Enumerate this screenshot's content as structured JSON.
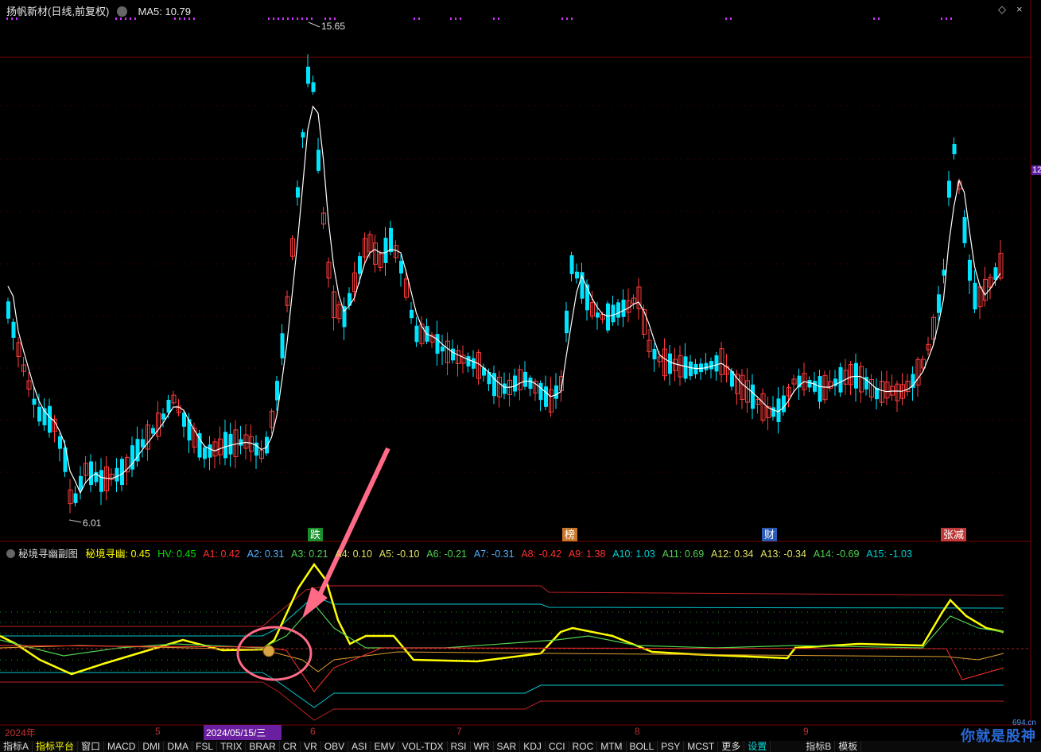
{
  "header": {
    "title": "扬帆新材(日线,前复权)",
    "ma_label": "MA5: 10.79"
  },
  "window_icons": {
    "diamond": "◇",
    "close": "×"
  },
  "price_labels": {
    "high": "15.65",
    "low": "6.01"
  },
  "right_axis_mark": "12",
  "event_tags": [
    {
      "label": "跌",
      "color": "#1a8f2e"
    },
    {
      "label": "榜",
      "color": "#c8762a"
    },
    {
      "label": "财",
      "color": "#2a5ab5"
    },
    {
      "label": "张减",
      "color": "#c03a3a"
    }
  ],
  "indicator": {
    "name": "秘境寻幽副图",
    "values": [
      {
        "text": "秘境寻幽: 0.45",
        "color": "#ffff00"
      },
      {
        "text": "HV: 0.45",
        "color": "#00e000"
      },
      {
        "text": "A1: 0.42",
        "color": "#ff3030"
      },
      {
        "text": "A2: 0.31",
        "color": "#4fb0ff"
      },
      {
        "text": "A3: 0.21",
        "color": "#50d050"
      },
      {
        "text": "A4: 0.10",
        "color": "#e0e060"
      },
      {
        "text": "A5: -0.10",
        "color": "#e0e060"
      },
      {
        "text": "A6: -0.21",
        "color": "#50d050"
      },
      {
        "text": "A7: -0.31",
        "color": "#4fb0ff"
      },
      {
        "text": "A8: -0.42",
        "color": "#ff3030"
      },
      {
        "text": "A9: 1.38",
        "color": "#ff3030"
      },
      {
        "text": "A10: 1.03",
        "color": "#00d0d0"
      },
      {
        "text": "A11: 0.69",
        "color": "#50d050"
      },
      {
        "text": "A12: 0.34",
        "color": "#e0e060"
      },
      {
        "text": "A13: -0.34",
        "color": "#e0e060"
      },
      {
        "text": "A14: -0.69",
        "color": "#50d050"
      },
      {
        "text": "A15: -1.03",
        "color": "#00d0d0"
      }
    ]
  },
  "x_axis": {
    "year": "2024年",
    "m5": "5",
    "date_cursor": "2024/05/15/三",
    "m6": "6",
    "m7": "7",
    "m8": "8",
    "m9": "9"
  },
  "tabs": [
    {
      "label": "指标A",
      "tone": "w"
    },
    {
      "label": "指标平台",
      "tone": "y"
    },
    {
      "label": "窗口",
      "tone": "w"
    },
    {
      "label": "MACD",
      "tone": "w"
    },
    {
      "label": "DMI",
      "tone": "w"
    },
    {
      "label": "DMA",
      "tone": "w"
    },
    {
      "label": "FSL",
      "tone": "w"
    },
    {
      "label": "TRIX",
      "tone": "w"
    },
    {
      "label": "BRAR",
      "tone": "w"
    },
    {
      "label": "CR",
      "tone": "w"
    },
    {
      "label": "VR",
      "tone": "w"
    },
    {
      "label": "OBV",
      "tone": "w"
    },
    {
      "label": "ASI",
      "tone": "w"
    },
    {
      "label": "EMV",
      "tone": "w"
    },
    {
      "label": "VOL-TDX",
      "tone": "w"
    },
    {
      "label": "RSI",
      "tone": "w"
    },
    {
      "label": "WR",
      "tone": "w"
    },
    {
      "label": "SAR",
      "tone": "w"
    },
    {
      "label": "KDJ",
      "tone": "w"
    },
    {
      "label": "CCI",
      "tone": "w"
    },
    {
      "label": "ROC",
      "tone": "w"
    },
    {
      "label": "MTM",
      "tone": "w"
    },
    {
      "label": "BOLL",
      "tone": "w"
    },
    {
      "label": "PSY",
      "tone": "w"
    },
    {
      "label": "MCST",
      "tone": "w"
    },
    {
      "label": "更多",
      "tone": "w"
    },
    {
      "label": "设置",
      "tone": "c"
    },
    {
      "label": "指标B",
      "tone": "w"
    },
    {
      "label": "模板",
      "tone": "w"
    }
  ],
  "watermark": {
    "text": "你就是股神",
    "sub": "694.cn"
  },
  "colors": {
    "up": "#ff3b3b",
    "down": "#00e5ff",
    "ma": "#ffffff",
    "annotation": "#ff5a7a"
  }
}
